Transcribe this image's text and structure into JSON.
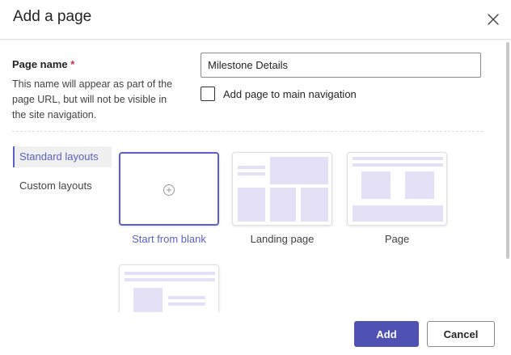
{
  "dialog": {
    "title": "Add a page",
    "close_icon": "close-icon"
  },
  "form": {
    "page_name_label": "Page name",
    "required_marker": "*",
    "description": "This name will appear as part of the page URL, but will not be visible in the site navigation.",
    "page_name_value": "Milestone Details",
    "add_to_nav_label": "Add page to main navigation",
    "add_to_nav_checked": false
  },
  "layout_tabs": [
    {
      "label": "Standard layouts",
      "active": true
    },
    {
      "label": "Custom layouts",
      "active": false
    }
  ],
  "templates": [
    {
      "label": "Start from blank",
      "selected": true,
      "icon": "plus-circle-icon"
    },
    {
      "label": "Landing page",
      "selected": false
    },
    {
      "label": "Page",
      "selected": false
    },
    {
      "label": "",
      "selected": false
    }
  ],
  "footer": {
    "add_label": "Add",
    "cancel_label": "Cancel"
  },
  "colors": {
    "accent": "#5b5fc7",
    "primary_button": "#4f52b2",
    "thumbnail_block": "#e4e1f6",
    "required": "#c4314b"
  }
}
